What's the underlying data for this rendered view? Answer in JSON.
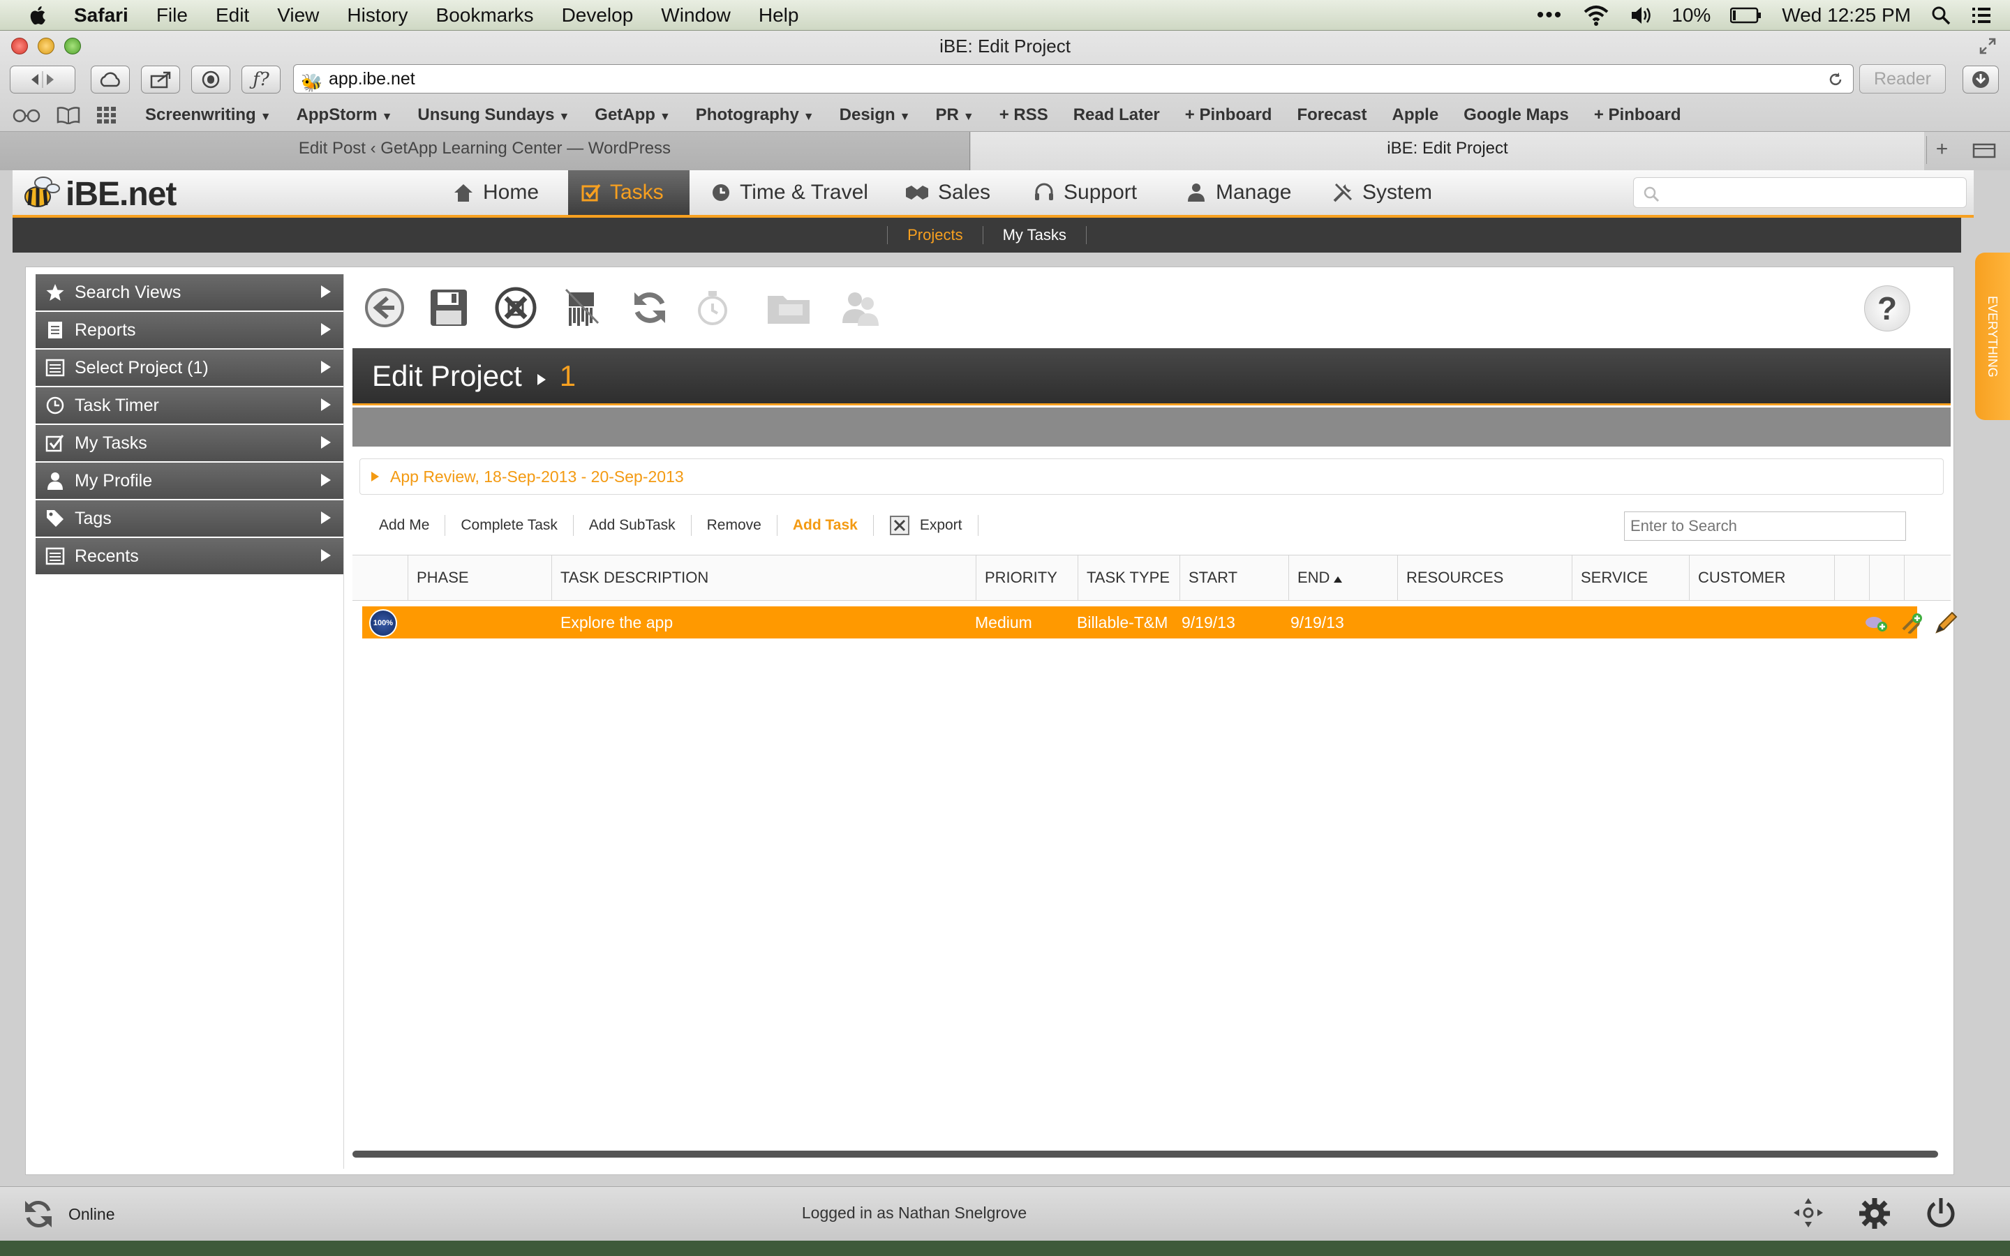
{
  "menubar": {
    "app": "Safari",
    "menus": [
      "File",
      "Edit",
      "View",
      "History",
      "Bookmarks",
      "Develop",
      "Window",
      "Help"
    ],
    "battery": "10%",
    "clock": "Wed 12:25 PM"
  },
  "browser": {
    "window_title": "iBE: Edit Project",
    "url": "app.ibe.net",
    "reader": "Reader",
    "bookmarks": [
      {
        "label": "Screenwriting",
        "dropdown": true
      },
      {
        "label": "AppStorm",
        "dropdown": true
      },
      {
        "label": "Unsung Sundays",
        "dropdown": true
      },
      {
        "label": "GetApp",
        "dropdown": true
      },
      {
        "label": "Photography",
        "dropdown": true
      },
      {
        "label": "Design",
        "dropdown": true
      },
      {
        "label": "PR",
        "dropdown": true
      },
      {
        "label": "+ RSS",
        "dropdown": false
      },
      {
        "label": "Read Later",
        "dropdown": false
      },
      {
        "label": "+ Pinboard",
        "dropdown": false
      },
      {
        "label": "Forecast",
        "dropdown": false
      },
      {
        "label": "Apple",
        "dropdown": false
      },
      {
        "label": "Google Maps",
        "dropdown": false
      },
      {
        "label": "+ Pinboard",
        "dropdown": false
      }
    ],
    "tabs": [
      "Edit Post ‹ GetApp Learning Center — WordPress",
      "iBE: Edit Project"
    ]
  },
  "app": {
    "logo": "iBE.net",
    "nav": [
      {
        "label": "Home",
        "icon": "home-icon"
      },
      {
        "label": "Tasks",
        "icon": "tasks-icon",
        "active": true
      },
      {
        "label": "Time & Travel",
        "icon": "clock-icon"
      },
      {
        "label": "Sales",
        "icon": "handshake-icon"
      },
      {
        "label": "Support",
        "icon": "headset-icon"
      },
      {
        "label": "Manage",
        "icon": "people-icon"
      },
      {
        "label": "System",
        "icon": "tools-icon"
      }
    ],
    "subnav": [
      "Projects",
      "My Tasks"
    ],
    "sidebar": [
      {
        "label": "Search Views",
        "icon": "star-icon"
      },
      {
        "label": "Reports",
        "icon": "document-icon"
      },
      {
        "label": "Select Project (1)",
        "icon": "list-icon"
      },
      {
        "label": "Task Timer",
        "icon": "clock-icon"
      },
      {
        "label": "My Tasks",
        "icon": "checkbox-icon"
      },
      {
        "label": "My Profile",
        "icon": "person-icon"
      },
      {
        "label": "Tags",
        "icon": "tag-icon"
      },
      {
        "label": "Recents",
        "icon": "list-icon"
      }
    ],
    "page_title": "Edit Project",
    "project_number": "1",
    "help": "?",
    "group": "App Review, 18-Sep-2013 - 20-Sep-2013",
    "grid_tools": [
      "Add Me",
      "Complete Task",
      "Add SubTask",
      "Remove",
      "Add Task",
      "Export"
    ],
    "grid_search_placeholder": "Enter to Search",
    "columns": [
      "PHASE",
      "TASK DESCRIPTION",
      "PRIORITY",
      "TASK TYPE",
      "START",
      "END",
      "RESOURCES",
      "SERVICE",
      "CUSTOMER"
    ],
    "rows": [
      {
        "progress": "100%",
        "phase": "",
        "description": "Explore the app",
        "priority": "Medium",
        "task_type": "Billable-T&M",
        "start": "9/19/13",
        "end": "9/19/13",
        "resources": "",
        "service": "",
        "customer": ""
      }
    ],
    "side_tab": "EVERYTHING",
    "footer": {
      "status": "Online",
      "logged_in": "Logged in as Nathan Snelgrove"
    }
  },
  "colors": {
    "accent": "#f7a020",
    "row_highlight": "#ff9900",
    "dark_bar": "#3a3a3a"
  }
}
